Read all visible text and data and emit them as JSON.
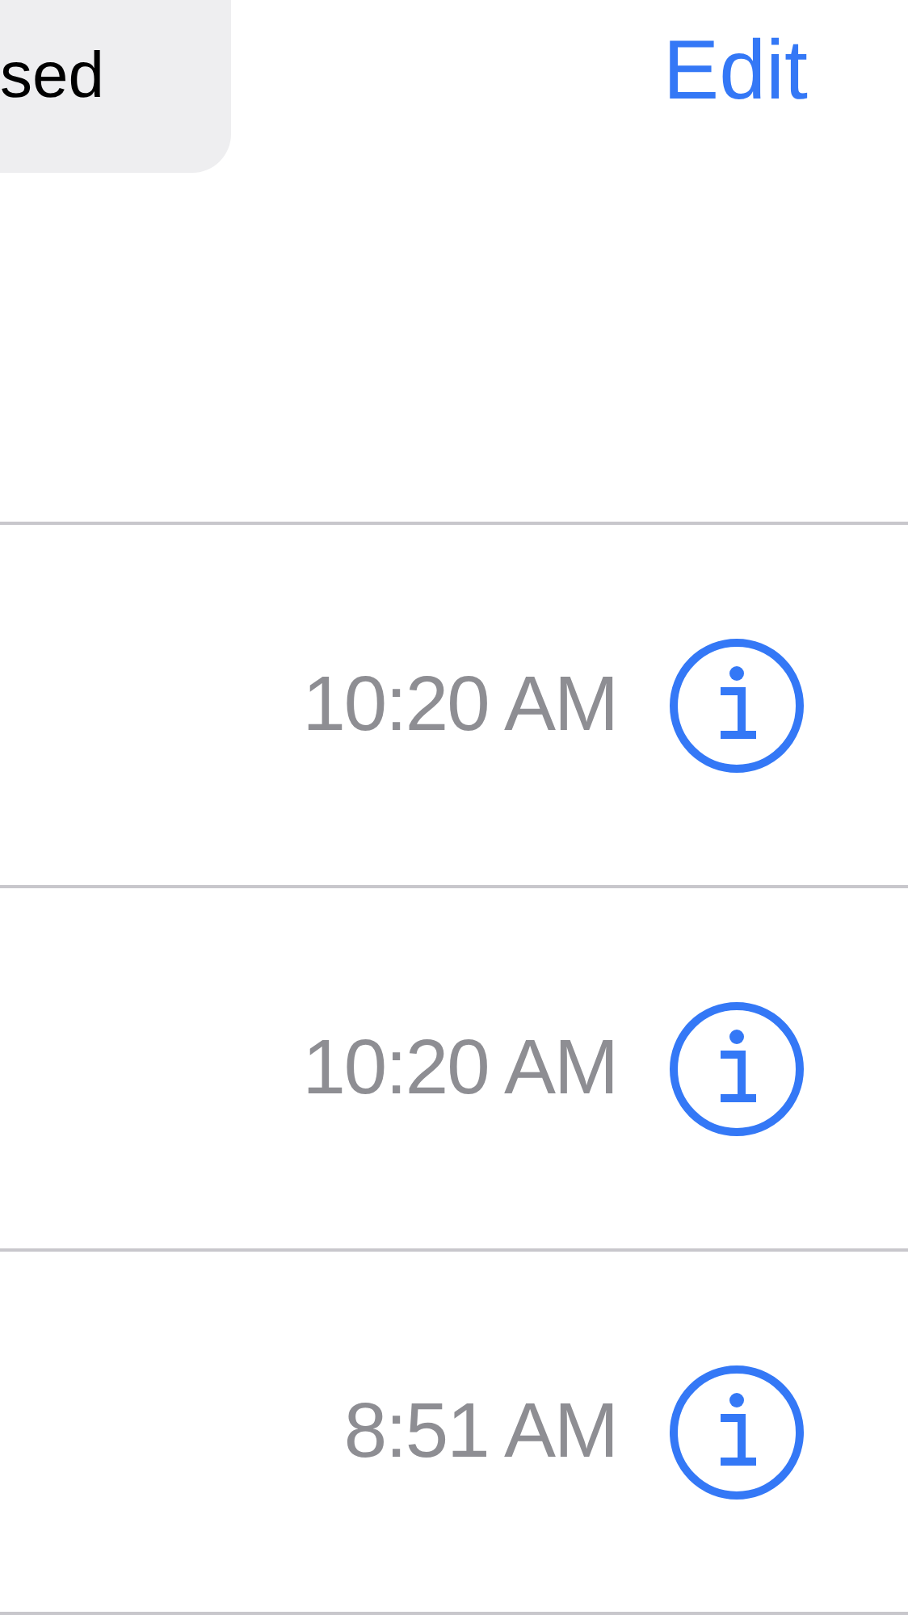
{
  "header": {
    "segment": {
      "label": "sed"
    },
    "edit_button": "Edit"
  },
  "calls": [
    {
      "time": "10:20 AM"
    },
    {
      "time": "10:20 AM"
    },
    {
      "time": "8:51 AM"
    }
  ]
}
